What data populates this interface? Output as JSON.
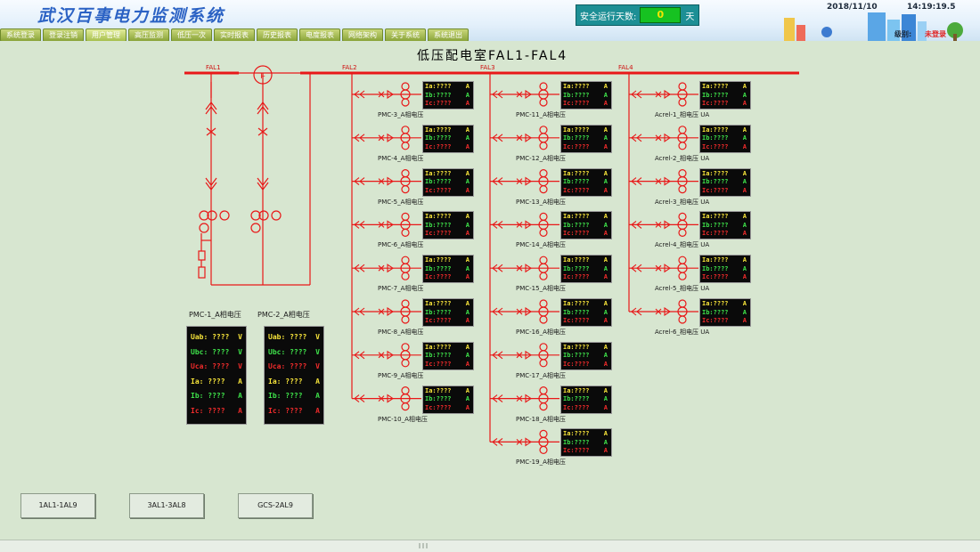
{
  "header": {
    "app_title": "武汉百事电力监测系统",
    "nav": [
      "系统登录",
      "登录注销",
      "用户管理",
      "高压监测",
      "低压一次",
      "实时报表",
      "历史报表",
      "电度报表",
      "网络架构",
      "关于系统",
      "系统退出"
    ],
    "safe_days_label": "安全运行天数:",
    "safe_days_value": "0",
    "safe_days_unit": "天",
    "date": "2018/11/10",
    "time": "14:19:19.5",
    "level_label": "级别:",
    "level_value": "未登录"
  },
  "page_title": "低压配电室FAL1-FAL4",
  "buses": [
    "FAL1",
    "FAL2",
    "FAL3",
    "FAL4"
  ],
  "breaker_symbol": "F",
  "meter_rows": [
    {
      "label": "Ia:",
      "value": "????",
      "unit": "A"
    },
    {
      "label": "Ib:",
      "value": "????",
      "unit": "A"
    },
    {
      "label": "Ic:",
      "value": "????",
      "unit": "A"
    }
  ],
  "feeders": {
    "col1": [
      "PMC-3_A相电压",
      "PMC-4_A相电压",
      "PMC-5_A相电压",
      "PMC-6_A相电压",
      "PMC-7_A相电压",
      "PMC-8_A相电压",
      "PMC-9_A相电压",
      "PMC-10_A相电压"
    ],
    "col2": [
      "PMC-11_A相电压",
      "PMC-12_A相电压",
      "PMC-13_A相电压",
      "PMC-14_A相电压",
      "PMC-15_A相电压",
      "PMC-16_A相电压",
      "PMC-17_A相电压",
      "PMC-18_A相电压",
      "PMC-19_A相电压"
    ],
    "col3": [
      "Acrel-1_相电压 UA",
      "Acrel-2_相电压 UA",
      "Acrel-3_相电压 UA",
      "Acrel-4_相电压 UA",
      "Acrel-5_相电压 UA",
      "Acrel-6_相电压 UA"
    ]
  },
  "pmc_meters": [
    {
      "label": "PMC-1_A相电压",
      "rows": [
        {
          "label": "Uab:",
          "value": "????",
          "unit": "V",
          "color": "#f7e43a"
        },
        {
          "label": "Ubc:",
          "value": "????",
          "unit": "V",
          "color": "#3ee14a"
        },
        {
          "label": "Uca:",
          "value": "????",
          "unit": "V",
          "color": "#ef2b2b"
        },
        {
          "label": "Ia:",
          "value": "????",
          "unit": "A",
          "color": "#f7e43a"
        },
        {
          "label": "Ib:",
          "value": "????",
          "unit": "A",
          "color": "#3ee14a"
        },
        {
          "label": "Ic:",
          "value": "????",
          "unit": "A",
          "color": "#ef2b2b"
        }
      ]
    },
    {
      "label": "PMC-2_A相电压",
      "rows": [
        {
          "label": "Uab:",
          "value": "????",
          "unit": "V",
          "color": "#f7e43a"
        },
        {
          "label": "Ubc:",
          "value": "????",
          "unit": "V",
          "color": "#3ee14a"
        },
        {
          "label": "Uca:",
          "value": "????",
          "unit": "V",
          "color": "#ef2b2b"
        },
        {
          "label": "Ia:",
          "value": "????",
          "unit": "A",
          "color": "#f7e43a"
        },
        {
          "label": "Ib:",
          "value": "????",
          "unit": "A",
          "color": "#3ee14a"
        },
        {
          "label": "Ic:",
          "value": "????",
          "unit": "A",
          "color": "#ef2b2b"
        }
      ]
    }
  ],
  "buttons": [
    "1AL1-1AL9",
    "3AL1-3AL8",
    "GCS-2AL9"
  ],
  "colors": {
    "line": "#e81818",
    "meter_bg": "#0a0a0a",
    "background": "#d7e6d0"
  }
}
